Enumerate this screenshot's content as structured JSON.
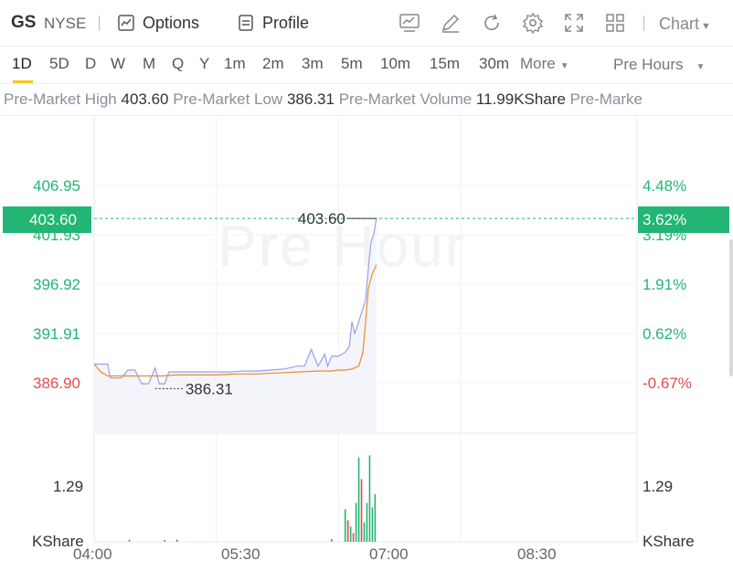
{
  "toolbar": {
    "symbol": "GS",
    "exchange": "NYSE",
    "options_label": "Options",
    "profile_label": "Profile",
    "chart_label": "Chart",
    "icons": [
      "chart-screen-icon",
      "pen-draw-icon",
      "refresh-icon",
      "gear-icon",
      "fullscreen-icon",
      "grid-layout-icon"
    ]
  },
  "periods": [
    "1D",
    "5D",
    "D",
    "W",
    "M",
    "Q",
    "Y",
    "1m",
    "2m",
    "3m",
    "5m",
    "10m",
    "15m",
    "30m"
  ],
  "active_period": "1D",
  "more_label": "More",
  "session_label": "Pre Hours",
  "stats": {
    "high_label": "Pre-Market High",
    "high_value": "403.60",
    "low_label": "Pre-Market Low",
    "low_value": "386.31",
    "volume_label": "Pre-Market Volume",
    "volume_value": "11.99KShare",
    "trailing_label": "Pre-Marke"
  },
  "watermark": "Pre Hour",
  "colors": {
    "up": "#22b573",
    "down": "#e54b4b",
    "avg_line": "#f08a24",
    "price_line": "#9aa0e6",
    "accent": "#f5c518"
  },
  "chart_data": {
    "type": "line",
    "x_ticks": [
      "04:00",
      "05:30",
      "07:00",
      "08:30"
    ],
    "price_ticks": [
      "406.95",
      "401.93",
      "396.92",
      "391.91",
      "386.90"
    ],
    "percent_ticks": [
      "4.48%",
      "3.19%",
      "1.91%",
      "0.62%",
      "-0.67%"
    ],
    "current_price": "403.60",
    "current_percent": "3.62%",
    "high_marker": "403.60",
    "low_marker": "386.31",
    "volume_tick": "1.29",
    "volume_unit": "KShare",
    "ylim": [
      386.9,
      406.95
    ],
    "series": [
      {
        "x": [
          "04:00",
          "04:10",
          "04:12",
          "04:20",
          "04:25",
          "04:30",
          "04:35",
          "04:40",
          "04:45",
          "04:48",
          "04:52",
          "04:55",
          "05:00",
          "05:10",
          "05:20",
          "05:30",
          "05:40",
          "05:50",
          "06:00",
          "06:10",
          "06:20",
          "06:30",
          "06:35",
          "06:40",
          "06:45",
          "06:50",
          "06:52",
          "06:55",
          "07:00",
          "07:05",
          "07:08",
          "07:10",
          "07:12",
          "07:15",
          "07:17",
          "07:20",
          "07:22",
          "07:24",
          "07:26",
          "07:28"
        ],
        "values": [
          388.8,
          388.8,
          387.4,
          387.4,
          388.2,
          388.2,
          386.8,
          386.8,
          388.4,
          386.8,
          386.8,
          388.0,
          388.0,
          388.0,
          388.0,
          388.0,
          388.0,
          388.1,
          388.1,
          388.2,
          388.3,
          388.6,
          388.6,
          390.3,
          388.6,
          389.8,
          388.6,
          389.6,
          389.6,
          390.0,
          390.6,
          393.1,
          391.9,
          393.1,
          394.0,
          395.3,
          398.5,
          401.2,
          402.0,
          403.6
        ]
      },
      {
        "x": [
          "04:00",
          "04:05",
          "04:10",
          "04:20",
          "04:30",
          "04:40",
          "04:50",
          "05:00",
          "05:15",
          "05:30",
          "05:45",
          "06:00",
          "06:15",
          "06:30",
          "06:45",
          "06:55",
          "07:00",
          "07:05",
          "07:10",
          "07:15",
          "07:18",
          "07:20",
          "07:22",
          "07:25",
          "07:28"
        ],
        "values": [
          388.8,
          388.0,
          387.6,
          387.6,
          387.6,
          387.6,
          387.6,
          387.7,
          387.7,
          387.7,
          387.8,
          387.8,
          387.9,
          388.0,
          388.1,
          388.1,
          388.2,
          388.2,
          388.3,
          388.6,
          390.0,
          393.0,
          396.5,
          398.0,
          398.9
        ]
      }
    ],
    "volume_bars": [
      {
        "t": "04:26",
        "v": 0.05,
        "dir": "up"
      },
      {
        "t": "04:52",
        "v": 0.04,
        "dir": "up"
      },
      {
        "t": "05:01",
        "v": 0.05,
        "dir": "down"
      },
      {
        "t": "06:55",
        "v": 0.06,
        "dir": "down"
      },
      {
        "t": "07:05",
        "v": 0.75,
        "dir": "up"
      },
      {
        "t": "07:07",
        "v": 0.5,
        "dir": "down"
      },
      {
        "t": "07:09",
        "v": 0.35,
        "dir": "up"
      },
      {
        "t": "07:11",
        "v": 0.2,
        "dir": "down"
      },
      {
        "t": "07:13",
        "v": 0.9,
        "dir": "up"
      },
      {
        "t": "07:15",
        "v": 1.95,
        "dir": "up"
      },
      {
        "t": "07:17",
        "v": 1.45,
        "dir": "down"
      },
      {
        "t": "07:19",
        "v": 0.45,
        "dir": "up"
      },
      {
        "t": "07:21",
        "v": 0.9,
        "dir": "up"
      },
      {
        "t": "07:23",
        "v": 2.0,
        "dir": "up"
      },
      {
        "t": "07:25",
        "v": 0.8,
        "dir": "up"
      },
      {
        "t": "07:27",
        "v": 1.1,
        "dir": "up"
      }
    ]
  }
}
